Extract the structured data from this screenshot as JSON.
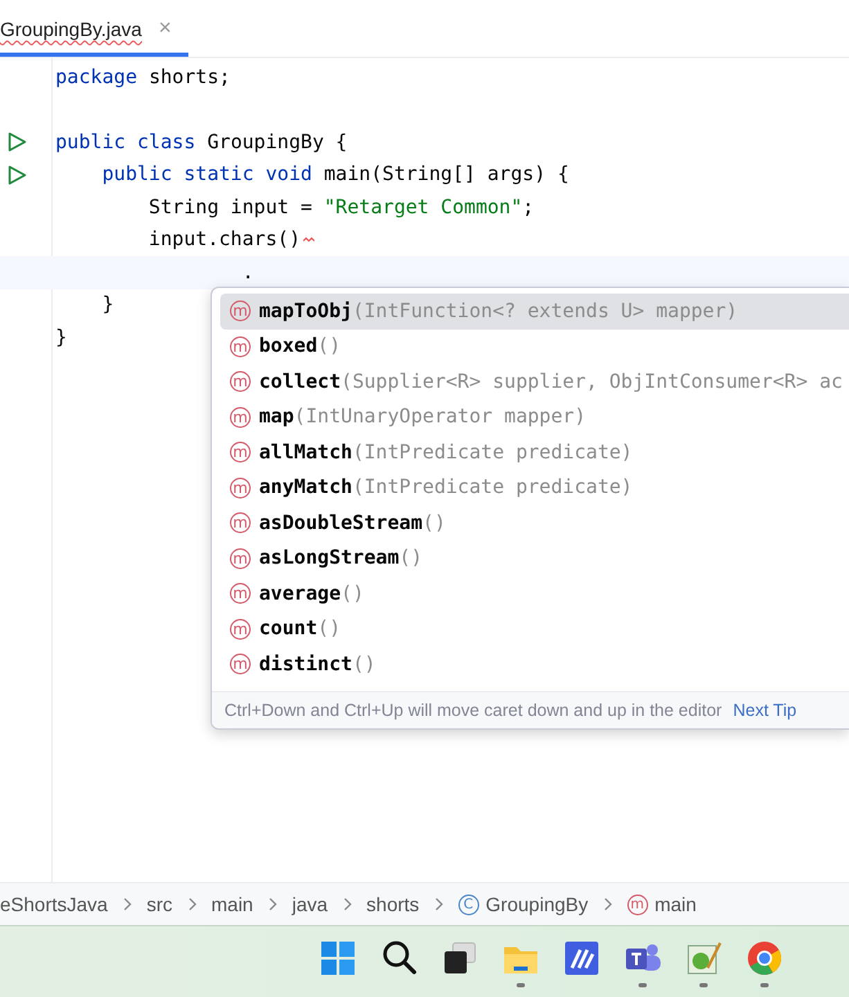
{
  "tab": {
    "label": "GroupingBy.java",
    "selected": true,
    "has_error": true,
    "close": "×"
  },
  "editor": {
    "lines": [
      {
        "current": false,
        "tokens": [
          {
            "kind": "keyword",
            "text": "package"
          },
          {
            "kind": "plain",
            "text": " shorts;"
          }
        ]
      },
      {
        "current": false
      },
      {
        "current": false,
        "gutter": [
          {
            "kind": "run"
          }
        ],
        "tokens": [
          {
            "kind": "keyword",
            "text": "public class"
          },
          {
            "kind": "plain",
            "text": " GroupingBy {"
          }
        ]
      },
      {
        "current": false,
        "gutter": [
          {
            "kind": "run"
          }
        ],
        "tokens": [
          {
            "kind": "keyword",
            "text": "    public static void"
          },
          {
            "kind": "plain",
            "text": " main(String[] args) {"
          }
        ]
      },
      {
        "current": false,
        "tokens": [
          {
            "kind": "plain",
            "text": "        String input = "
          },
          {
            "kind": "string",
            "text": "\"Retarget Common\""
          },
          {
            "kind": "plain",
            "text": ";"
          }
        ]
      },
      {
        "current": false,
        "tokens": [
          {
            "kind": "plain",
            "text": "        input.chars()"
          },
          {
            "kind": "error-mark"
          }
        ]
      },
      {
        "current": true,
        "tokens": [
          {
            "kind": "plain",
            "text": "                ."
          }
        ]
      },
      {
        "current": false,
        "tokens": [
          {
            "kind": "plain",
            "text": "    }"
          }
        ]
      },
      {
        "current": false,
        "tokens": [
          {
            "kind": "plain",
            "text": "}"
          }
        ]
      }
    ]
  },
  "completion": {
    "items": [
      {
        "icon": "m",
        "name": "mapToObj",
        "signature": "(IntFunction<? extends U> mapper)",
        "selected": true
      },
      {
        "icon": "m",
        "name": "boxed",
        "signature": "()",
        "selected": false
      },
      {
        "icon": "m",
        "name": "collect",
        "signature": "(Supplier<R> supplier, ObjIntConsumer<R> ac",
        "selected": false
      },
      {
        "icon": "m",
        "name": "map",
        "signature": "(IntUnaryOperator mapper)",
        "selected": false
      },
      {
        "icon": "m",
        "name": "allMatch",
        "signature": "(IntPredicate predicate)",
        "selected": false
      },
      {
        "icon": "m",
        "name": "anyMatch",
        "signature": "(IntPredicate predicate)",
        "selected": false
      },
      {
        "icon": "m",
        "name": "asDoubleStream",
        "signature": "()",
        "selected": false
      },
      {
        "icon": "m",
        "name": "asLongStream",
        "signature": "()",
        "selected": false
      },
      {
        "icon": "m",
        "name": "average",
        "signature": "()",
        "selected": false
      },
      {
        "icon": "m",
        "name": "count",
        "signature": "()",
        "selected": false
      },
      {
        "icon": "m",
        "name": "distinct",
        "signature": "()",
        "selected": false
      }
    ],
    "hint": "Ctrl+Down and Ctrl+Up will move caret down and up in the editor",
    "link": "Next Tip"
  },
  "breadcrumbs": [
    {
      "kind": "plain",
      "label": "eShortsJava"
    },
    {
      "kind": "plain",
      "label": "src"
    },
    {
      "kind": "plain",
      "label": "main"
    },
    {
      "kind": "plain",
      "label": "java"
    },
    {
      "kind": "plain",
      "label": "shorts"
    },
    {
      "kind": "class",
      "badge": "C",
      "label": "GroupingBy"
    },
    {
      "kind": "method",
      "badge": "m",
      "label": "main"
    }
  ],
  "taskbar": [
    {
      "kind": "start",
      "running": false
    },
    {
      "kind": "search",
      "running": false
    },
    {
      "kind": "taskview",
      "running": false
    },
    {
      "kind": "folder",
      "running": true
    },
    {
      "kind": "editor-app",
      "running": false
    },
    {
      "kind": "chat-app",
      "running": true
    },
    {
      "kind": "paint-app",
      "running": true
    },
    {
      "kind": "browser",
      "running": true
    }
  ]
}
